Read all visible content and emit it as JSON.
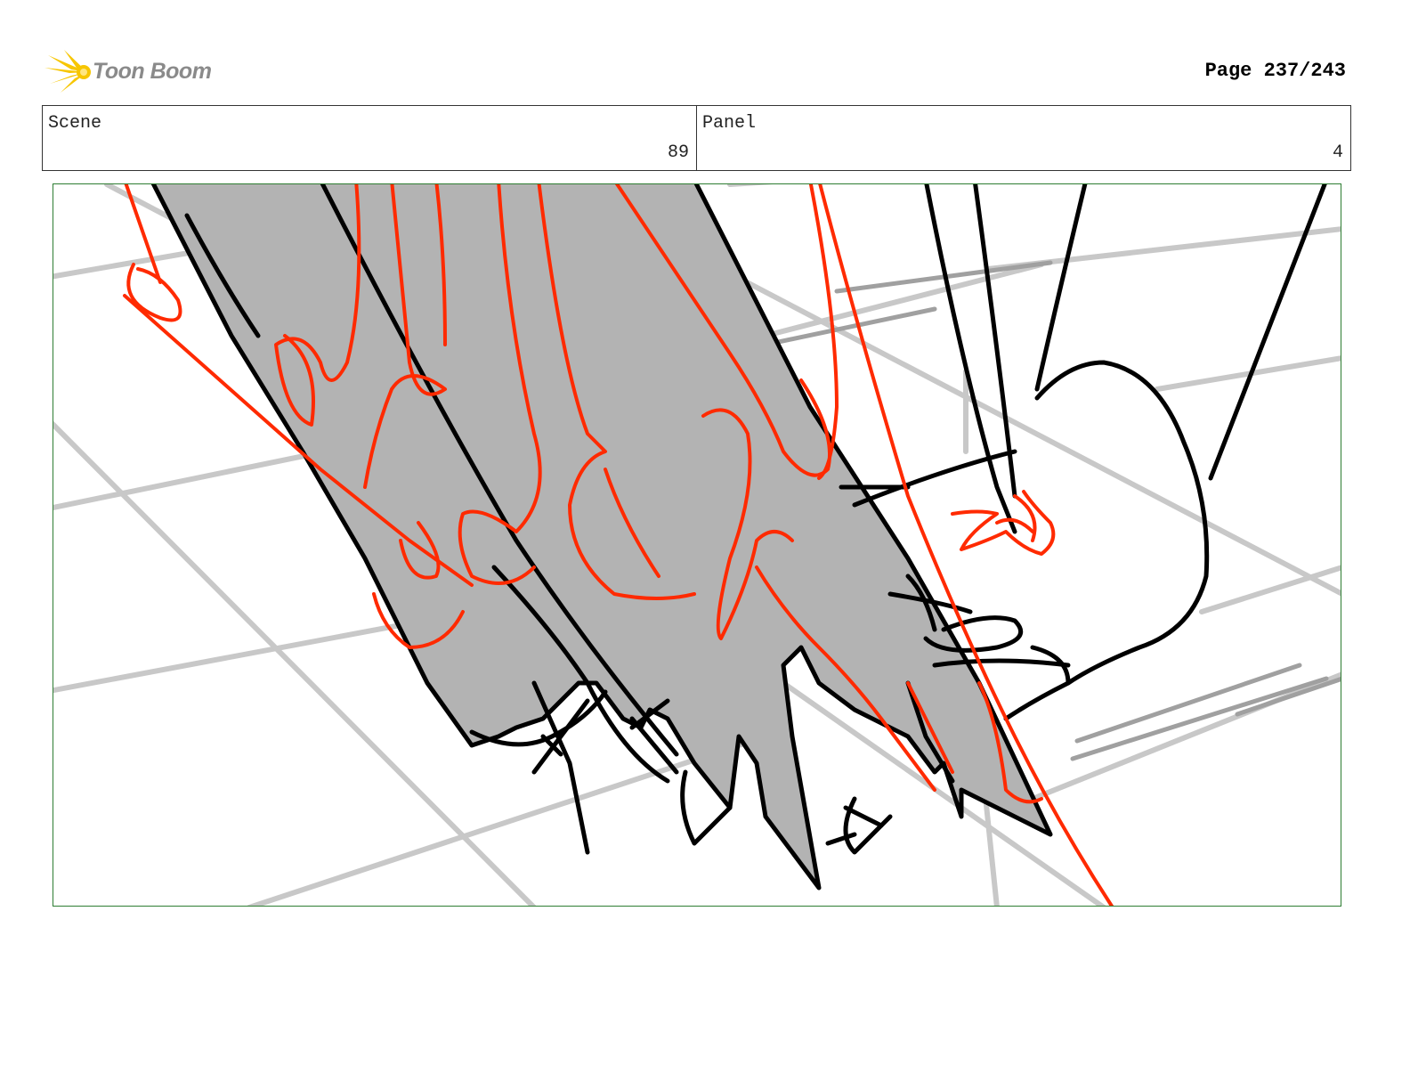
{
  "header": {
    "logo_text": "Toon Boom",
    "page_label": "Page 237/243"
  },
  "info": {
    "scene_label": "Scene",
    "scene_value": "89",
    "panel_label": "Panel",
    "panel_value": "4"
  },
  "colors": {
    "frame_border": "#2e7d32",
    "sketch_red": "#ff2a00",
    "sketch_gray_fill": "#b3b3b3",
    "guide_gray": "#c8c8c8",
    "logo_yellow": "#f7c600"
  },
  "icons": {
    "logo": "toon-boom-burst-icon"
  }
}
